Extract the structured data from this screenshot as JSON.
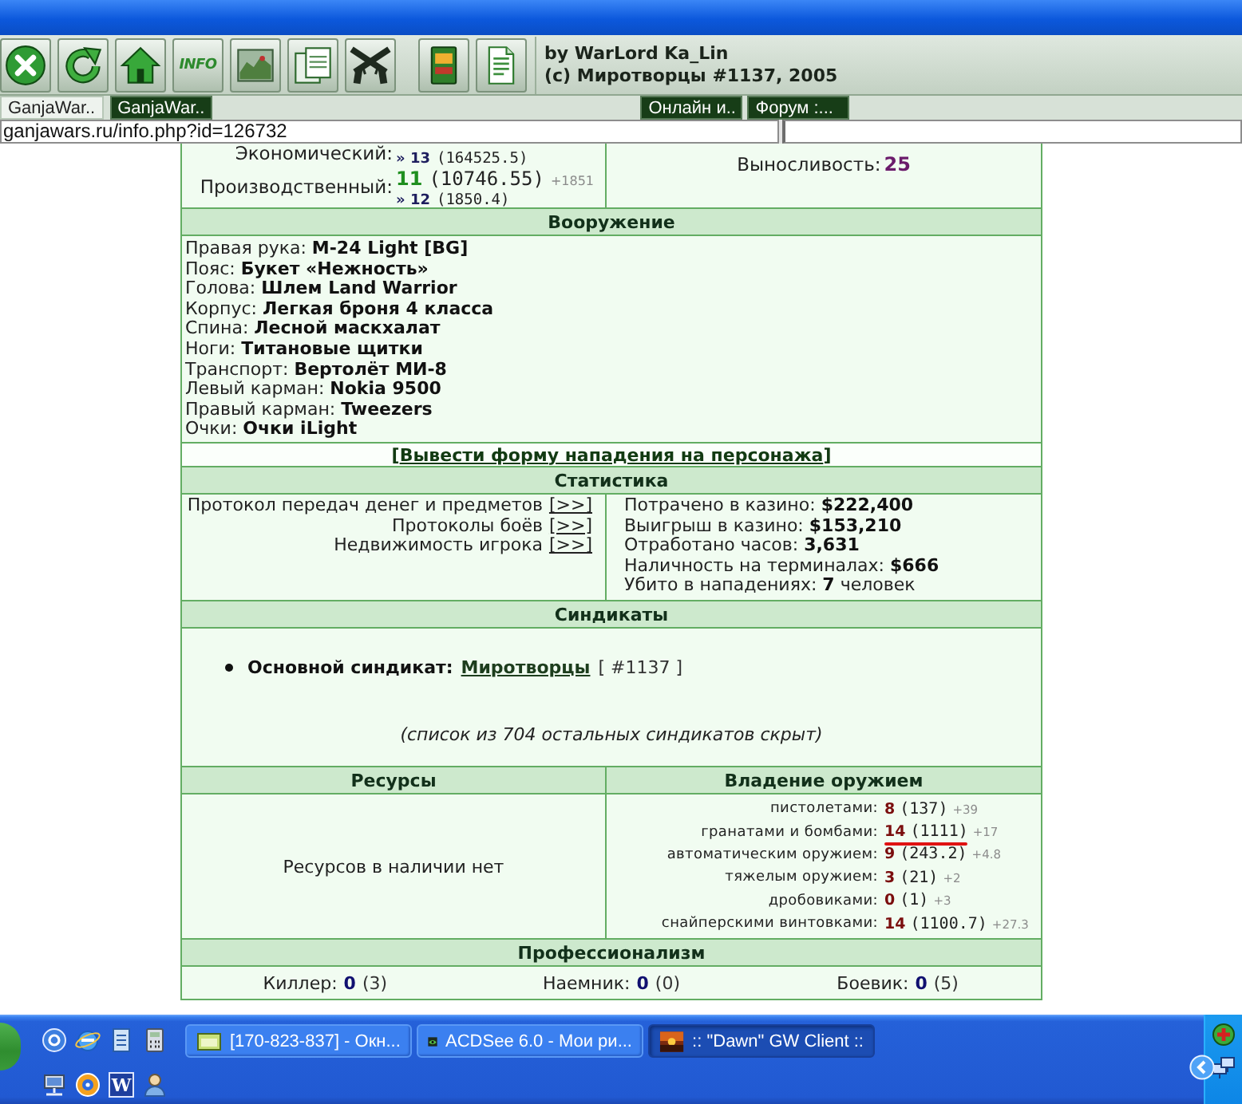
{
  "toolbar": {
    "button_groups": [
      {
        "buttons": [
          {
            "kind": "close"
          },
          {
            "kind": "refresh"
          },
          {
            "kind": "home"
          },
          {
            "kind": "info",
            "label": "INFO"
          },
          {
            "kind": "picture"
          },
          {
            "kind": "documents"
          },
          {
            "kind": "weapons"
          }
        ]
      },
      {
        "buttons": [
          {
            "kind": "book"
          },
          {
            "kind": "page"
          }
        ]
      }
    ],
    "credits": [
      "by WarLord Ka_Lin",
      "(c) Миротворцы #1137, 2005"
    ]
  },
  "tabs": [
    {
      "label": "GanjaWar..",
      "selected": true
    },
    {
      "label": "GanjaWar..",
      "selected": false
    }
  ],
  "quick_links": [
    "Онлайн и..",
    "Форум :..."
  ],
  "address_bar": {
    "value": "ganjawars.ru/info.php?id=126732"
  },
  "skills": [
    {
      "name": "Экономический:",
      "next": "» 13",
      "next_value": "(164525.5)"
    },
    {
      "name": "Производственный:",
      "rank": "11",
      "value": "(10746.55)",
      "gain": "+1851",
      "next": "» 12",
      "next_value": "(1850.4)"
    }
  ],
  "vitals": [
    {
      "label": "Выносливость:",
      "value": "25"
    }
  ],
  "equipment": {
    "title": "Вооружение",
    "items": [
      "Правая рука: **M-24 Light [BG]**",
      "Пояс: **Букет «Нежность»**",
      "Голова: **Шлем Land Warrior**",
      "Корпус: **Легкая броня 4 класса**",
      "Спина: **Лесной маскхалат**",
      "Ноги: **Титановые щитки**",
      "Транспорт: **Вертолёт МИ-8**",
      "Левый карман: **Nokia 9500**",
      "Правый карман: **Tweezers**",
      "Очки: **Очки iLight**"
    ]
  },
  "attack_link": {
    "open": "[",
    "label": "Вывести форму нападения на персонажа",
    "close": "]"
  },
  "statistics": {
    "title": "Статистика",
    "protocols": [
      {
        "label": "Протокол передач денег и предметов",
        "link": "[>>]"
      },
      {
        "label": "Протоколы боёв",
        "link": "[>>]"
      },
      {
        "label": "Недвижимость игрока",
        "link": "[>>]"
      }
    ],
    "totals": [
      "Потрачено в казино: **$222,400**",
      "Выигрыш в казино: **$153,210**",
      "Отработано часов: **3,631**",
      "Наличность на терминалах: **$666**",
      "Убито в нападениях: **7** человек"
    ]
  },
  "syndicates": {
    "title": "Синдикаты",
    "main": {
      "label": "Основной синдикат:",
      "name": "Миротворцы",
      "number": "[ #1137 ]"
    },
    "note": "(список из 704 остальных синдикатов скрыт)"
  },
  "resources": {
    "title": "Ресурсы",
    "text": "Ресурсов в наличии нет"
  },
  "weapons": {
    "title": "Владение оружием",
    "items": [
      {
        "name": "пистолетами:",
        "rank": "8",
        "value": "(137)",
        "gain": "+39",
        "highlighted": false
      },
      {
        "name": "гранатами и бомбами:",
        "rank": "14",
        "value": "(1111)",
        "gain": "+17",
        "highlighted": true
      },
      {
        "name": "автоматическим оружием:",
        "rank": "9",
        "value": "(243.2)",
        "gain": "+4.8",
        "highlighted": false
      },
      {
        "name": "тяжелым оружием:",
        "rank": "3",
        "value": "(21)",
        "gain": "+2",
        "highlighted": false
      },
      {
        "name": "дробовиками:",
        "rank": "0",
        "value": "(1)",
        "gain": "+3",
        "highlighted": false
      },
      {
        "name": "снайперскими винтовками:",
        "rank": "14",
        "value": "(1100.7)",
        "gain": "+27.3",
        "highlighted": false
      }
    ]
  },
  "professionalism": {
    "title": "Профессионализм",
    "items": [
      {
        "name": "Киллер:",
        "rank": "0",
        "value": "(3)"
      },
      {
        "name": "Наемник:",
        "rank": "0",
        "value": "(0)"
      },
      {
        "name": "Боевик:",
        "rank": "0",
        "value": "(5)"
      }
    ]
  },
  "taskbar": {
    "quick_launch": [
      {
        "kind": "mail"
      },
      {
        "kind": "browser"
      },
      {
        "kind": "notes"
      },
      {
        "kind": "calculator"
      },
      {
        "kind": "network"
      },
      {
        "kind": "media"
      },
      {
        "kind": "letter",
        "label": "W"
      },
      {
        "kind": "messenger"
      }
    ],
    "tasks": [
      {
        "kind": "chat",
        "label": "[170-823-837] - Окн...",
        "selected": false
      },
      {
        "kind": "viewer",
        "label": "ACDSee 6.0 - Мои ри...",
        "selected": false
      },
      {
        "kind": "game",
        "label": ":: \"Dawn\" GW Client ::",
        "selected": true
      }
    ]
  }
}
